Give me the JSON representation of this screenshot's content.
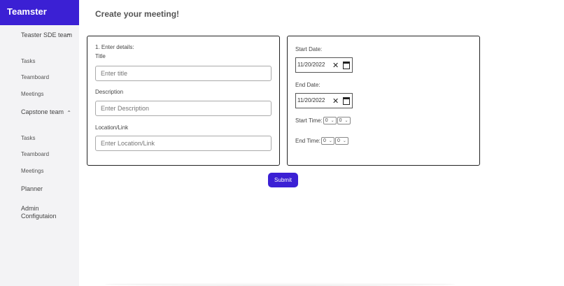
{
  "app": {
    "brand": "Teamster"
  },
  "sidebar": {
    "groups": [
      {
        "label": "Teaster SDE team",
        "items": [
          "Tasks",
          "Teamboard",
          "Meetings"
        ]
      },
      {
        "label": "Capstone team",
        "items": [
          "Tasks",
          "Teamboard",
          "Meetings"
        ]
      }
    ],
    "top_items": [
      "Planner",
      "Admin Configutaion"
    ]
  },
  "main": {
    "title": "Create your meeting!",
    "details": {
      "heading": "1. Enter details:",
      "title_label": "Title",
      "title_placeholder": "Enter title",
      "description_label": "Description",
      "description_placeholder": "Enter Description",
      "location_label": "Location/Link",
      "location_placeholder": "Enter Location/Link"
    },
    "schedule": {
      "start_date_label": "Start Date:",
      "start_date_value": "11/20/2022",
      "end_date_label": "End Date:",
      "end_date_value": "11/20/2022",
      "start_time_label": "Start Time:",
      "start_hour": "0",
      "start_minute": "0",
      "end_time_label": "End Time:",
      "end_hour": "0",
      "end_minute": "0"
    },
    "submit_label": "Submit"
  },
  "colors": {
    "brand": "#3b20d4",
    "sidebar_bg": "#f3f3f5"
  }
}
